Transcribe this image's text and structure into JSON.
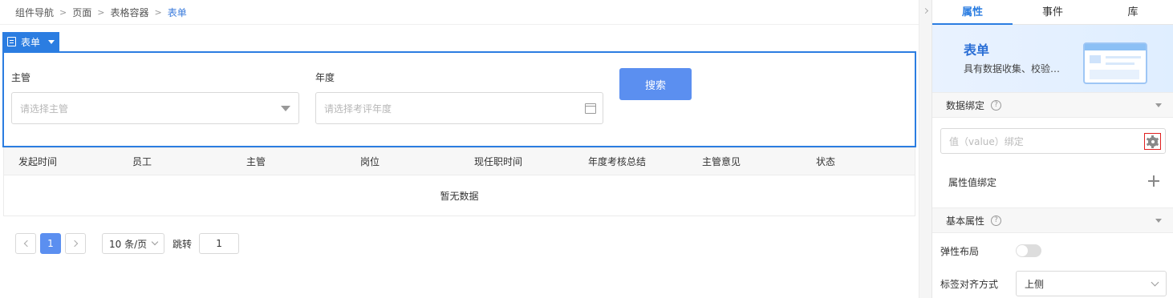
{
  "breadcrumb": {
    "items": [
      "组件导航",
      "页面",
      "表格容器"
    ],
    "current": "表单"
  },
  "form_tag": {
    "label": "表单"
  },
  "form": {
    "supervisor_label": "主管",
    "supervisor_placeholder": "请选择主管",
    "year_label": "年度",
    "year_placeholder": "请选择考评年度",
    "search_button": "搜索"
  },
  "table": {
    "columns": [
      "发起时间",
      "员工",
      "主管",
      "岗位",
      "现任职时间",
      "年度考核总结",
      "主管意见",
      "状态"
    ],
    "empty_text": "暂无数据"
  },
  "pager": {
    "current_page": "1",
    "page_size": "10 条/页",
    "jump_label": "跳转",
    "jump_value": "1"
  },
  "panel": {
    "tabs": [
      "属性",
      "事件",
      "库"
    ],
    "active_tab": "属性",
    "hero_title": "表单",
    "hero_desc": "具有数据收集、校验…",
    "data_binding_title": "数据绑定",
    "value_binding_placeholder": "值（value）绑定",
    "attr_binding_label": "属性值绑定",
    "basic_attrs_title": "基本属性",
    "flex_layout_label": "弹性布局",
    "flex_layout_on": false,
    "label_align_label": "标签对齐方式",
    "label_align_value": "上侧"
  },
  "colors": {
    "accent": "#2b7de1",
    "primary_button": "#5b8ff0",
    "highlight_border": "#e02020"
  }
}
